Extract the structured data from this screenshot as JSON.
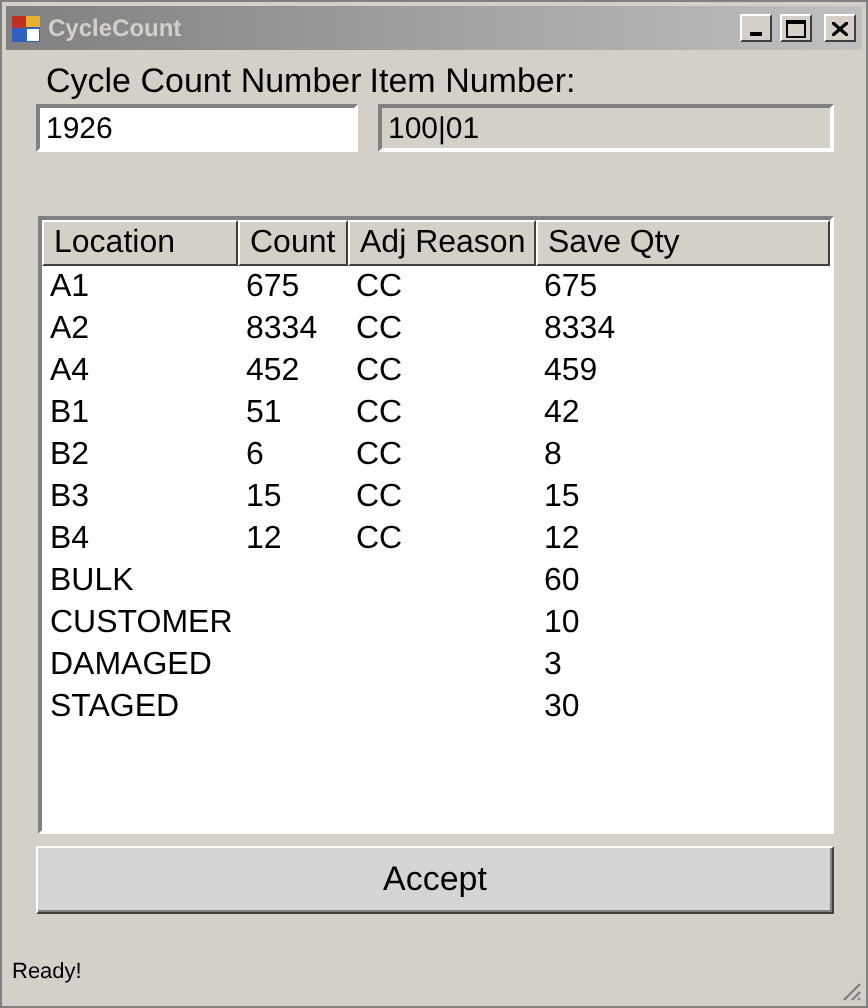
{
  "window": {
    "title": "CycleCount"
  },
  "fields": [
    {
      "label": "Cycle Count Number",
      "value": "1926",
      "disabled": false
    },
    {
      "label": "Item Number:",
      "value": "100|01",
      "disabled": true
    }
  ],
  "table": {
    "columns": [
      "Location",
      "Count",
      "Adj Reason",
      "Save Qty"
    ],
    "rows": [
      [
        "A1",
        "675",
        "CC",
        "675"
      ],
      [
        "A2",
        "8334",
        "CC",
        "8334"
      ],
      [
        "A4",
        "452",
        "CC",
        "459"
      ],
      [
        "B1",
        "51",
        "CC",
        "42"
      ],
      [
        "B2",
        "6",
        "CC",
        "8"
      ],
      [
        "B3",
        "15",
        "CC",
        "15"
      ],
      [
        "B4",
        "12",
        "CC",
        "12"
      ],
      [
        "BULK",
        "",
        "",
        "60"
      ],
      [
        "CUSTOMER",
        "",
        "",
        "10"
      ],
      [
        "DAMAGED",
        "",
        "",
        "3"
      ],
      [
        "STAGED",
        "",
        "",
        "30"
      ]
    ]
  },
  "button": "Accept",
  "status_bar": "Ready!"
}
